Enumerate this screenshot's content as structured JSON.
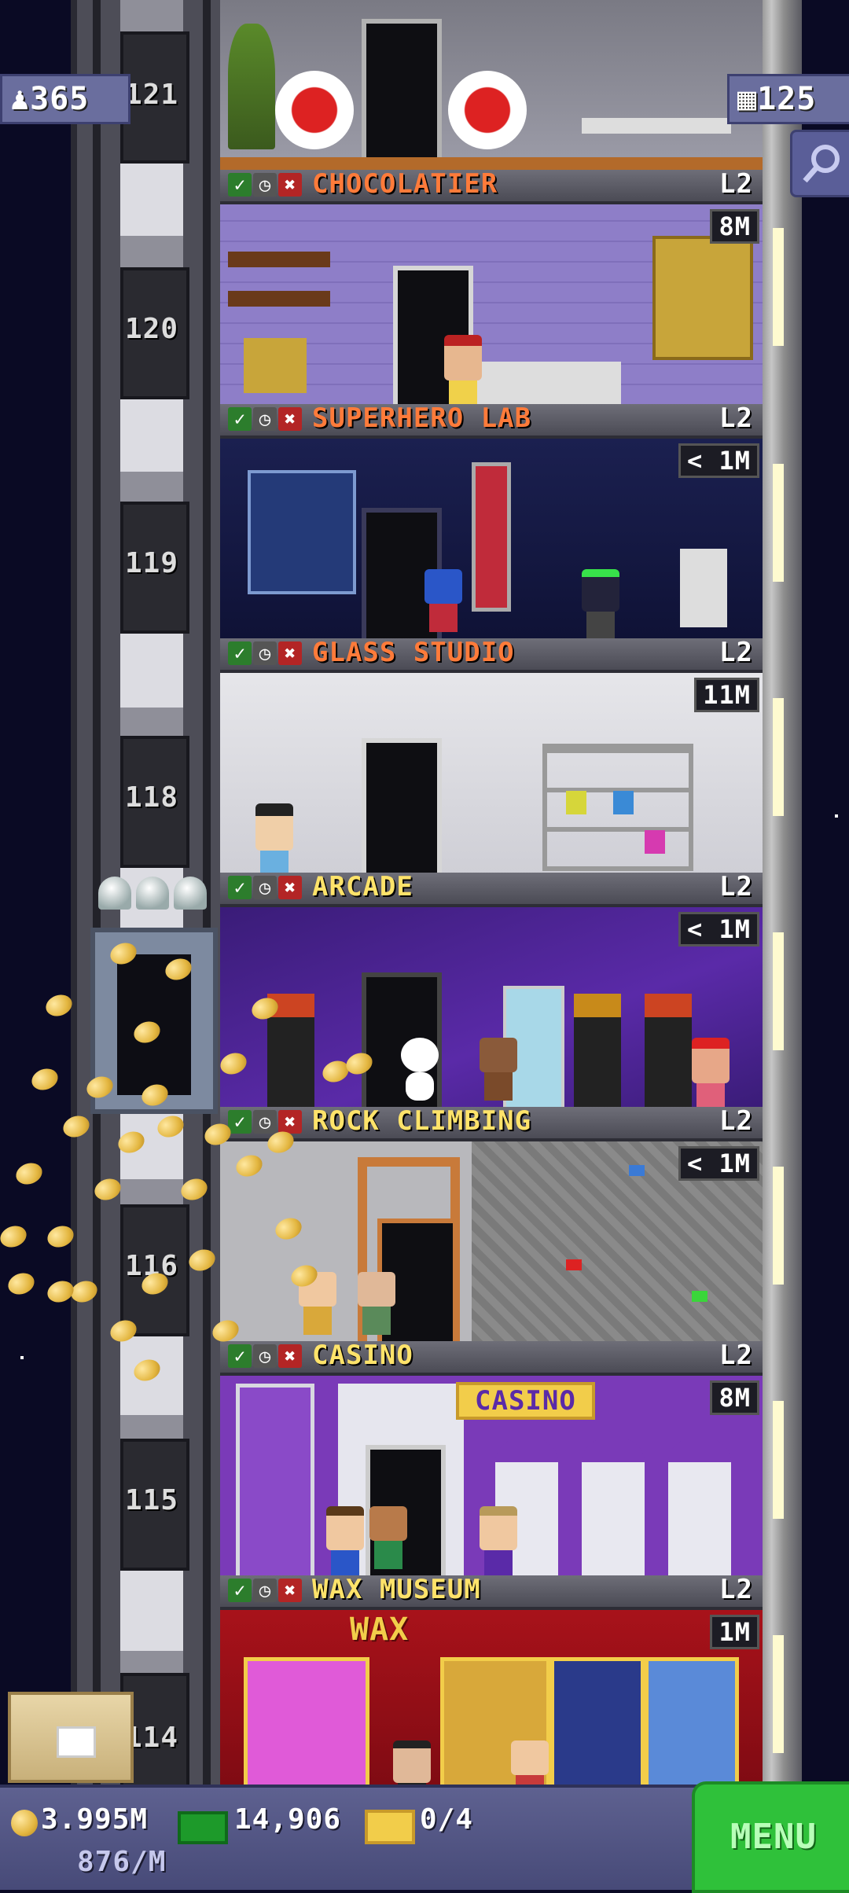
{
  "hud": {
    "population": "365",
    "floors": "125",
    "population_icon": "person-icon",
    "floors_icon": "building-icon",
    "search_icon": "magnifier-icon"
  },
  "shaft_numbers": [
    "121",
    "120",
    "119",
    "118",
    "116",
    "115",
    "114"
  ],
  "floors": [
    {
      "name": "CHOCOLATIER",
      "level": "L2",
      "timer": "8M",
      "color": "#ff7b3a"
    },
    {
      "name": "SUPERHERO LAB",
      "level": "L2",
      "timer": "< 1M",
      "color": "#ff7b3a"
    },
    {
      "name": "GLASS STUDIO",
      "level": "L2",
      "timer": "11M",
      "color": "#ff7b3a"
    },
    {
      "name": "ARCADE",
      "level": "L2",
      "timer": "< 1M",
      "color": "#ffe36a"
    },
    {
      "name": "ROCK CLIMBING",
      "level": "L2",
      "timer": "< 1M",
      "color": "#ffe36a"
    },
    {
      "name": "CASINO",
      "level": "L2",
      "timer": "8M",
      "color": "#ffe36a"
    },
    {
      "name": "WAX MUSEUM",
      "level": "L2",
      "timer": "1M",
      "color": "#ffe36a"
    }
  ],
  "casino_sign": "CASINO",
  "wax_sign": "WAX",
  "bottom": {
    "coins": "3.995M",
    "coins_rate": "876/M",
    "bux": "14,906",
    "tickets": "0/4",
    "menu_label": "MENU"
  },
  "colors": {
    "menu_green": "#2fc13a",
    "hud_purple": "#6a6e9e",
    "name_orange": "#ff7b3a",
    "name_yellow": "#ffe36a"
  }
}
